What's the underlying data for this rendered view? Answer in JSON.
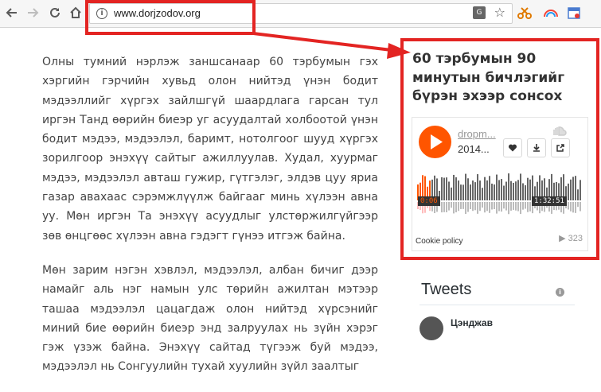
{
  "browser": {
    "url": "www.dorjzodov.org",
    "icons": [
      "back-icon",
      "forward-icon",
      "reload-icon",
      "home-icon",
      "info-icon",
      "translate-icon",
      "star-icon",
      "scissors-icon",
      "rainbow-icon",
      "calendar-icon"
    ]
  },
  "article": {
    "paragraphs": [
      "Олны тумний нэрлэж заншсанаар 60 тэрбумын гэх хэргийн гэрчийн хувьд олон нийтэд үнэн бодит мэдээллийг хүргэх зайлшгүй шаардлага гарсан тул иргэн Танд өөрийн биеэр уг асуудалтай холбоотой үнэн бодит мэдээ, мэдээлэл, баримт, нотолгоог шууд хүргэх зорилгоор энэхүү сайтыг ажиллуулав. Худал, хуурмаг мэдээ, мэдээлэл авташ гужир, гүтгэлэг, элдэв цуу яриа газар авахаас сэрэмжлүүлж байгааг минь хүлээн авна уу. Мөн иргэн Та энэхүү асуудлыг улстөржилгүйгээр зөв өнцгөөс хүлээн авна гэдэгт гүнээ итгэж байна.",
      "Мөн зарим нэгэн хэвлэл, мэдээлэл, албан бичиг дээр намайг аль нэг намын улс төрийн ажилтан мэтээр ташаа мэдээлэл цацагдаж олон нийтэд хүрсэнийг миний бие өөрийн биеэр энд залруулах нь зүйн хэрэг гэж үзэж байна. Энэхүү сайтад түгээж буй мэдээ, мэдээлэл нь Сонгуулийн тухай хуулийн зүйл заалтыг"
    ]
  },
  "sidebar": {
    "title": "60 тэрбумын 90 минутын бичлэгийг бүрэн эхээр сонсох",
    "player": {
      "user": "dropm...",
      "track": "2014...",
      "time_current": "0:06",
      "time_total": "1:32:51",
      "cookie_policy": "Cookie policy",
      "plays": "323",
      "accent": "#ff5500"
    },
    "tweets_title": "Tweets",
    "tweet_user": "Цэнджав"
  },
  "highlight_color": "#e32422"
}
